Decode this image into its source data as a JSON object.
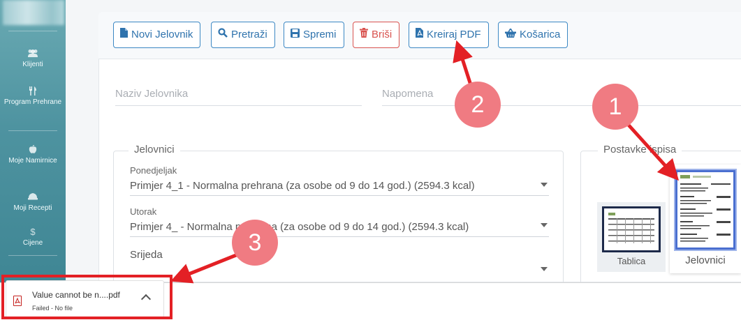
{
  "sidebar": {
    "items": [
      {
        "label": "Klijenti",
        "icon": "users-icon"
      },
      {
        "label": "Program Prehrane",
        "icon": "cutlery-icon"
      },
      {
        "label": "Moje Namirnice",
        "icon": "apple-icon"
      },
      {
        "label": "Moji Recepti",
        "icon": "chef-hat-icon"
      },
      {
        "label": "Cijene",
        "icon": "dollar-icon"
      }
    ]
  },
  "toolbar": {
    "new_label": "Novi Jelovnik",
    "search_label": "Pretraži",
    "save_label": "Spremi",
    "delete_label": "Briši",
    "pdf_label": "Kreiraj PDF",
    "cart_label": "Košarica"
  },
  "form": {
    "name_placeholder": "Naziv Jelovnika",
    "note_placeholder": "Napomena"
  },
  "jelovnici": {
    "legend": "Jelovnici",
    "days": [
      {
        "label": "Ponedjeljak",
        "value": "Primjer 4_1 - Normalna prehrana (za osobe od 9 do 14 god.) (2594.3 kcal)"
      },
      {
        "label": "Utorak",
        "value": "Primjer 4_ - Normalna prehrana (za osobe od 9 do 14 god.) (2594.3 kcal)"
      },
      {
        "label": "Srijeda",
        "value": ""
      }
    ]
  },
  "postavke": {
    "legend": "Postavke ispisa",
    "options": [
      {
        "label": "Tablica"
      },
      {
        "label": "Jelovnici",
        "selected": true
      }
    ]
  },
  "download": {
    "file_name": "Value cannot be n....pdf",
    "status": "Failed - No file"
  },
  "annotations": {
    "markers": [
      "1",
      "2",
      "3"
    ],
    "color": "#f07b82",
    "arrow_color": "#e32025"
  }
}
